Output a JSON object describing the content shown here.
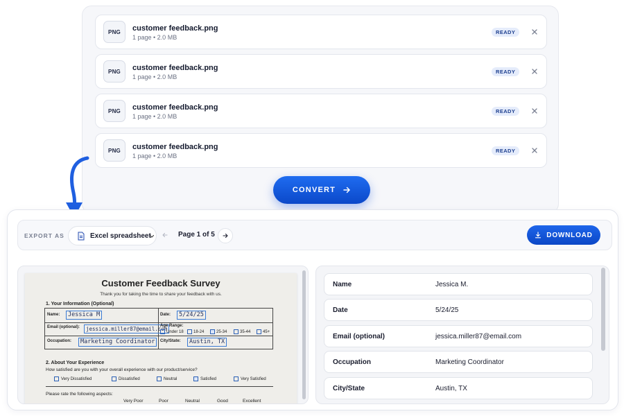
{
  "uploader": {
    "files": [
      {
        "badge": "PNG",
        "name": "customer feedback.png",
        "meta": "1 page  •  2.0 MB",
        "status": "READY"
      },
      {
        "badge": "PNG",
        "name": "customer feedback.png",
        "meta": "1 page  •  2.0 MB",
        "status": "READY"
      },
      {
        "badge": "PNG",
        "name": "customer feedback.png",
        "meta": "1 page  •  2.0 MB",
        "status": "READY"
      },
      {
        "badge": "PNG",
        "name": "customer feedback.png",
        "meta": "1 page  •  2.0 MB",
        "status": "READY"
      }
    ],
    "convert_label": "CONVERT"
  },
  "toolbar": {
    "export_label": "EXPORT AS",
    "format": "Excel spreadsheet",
    "page_label": "Page 1 of 5",
    "download_label": "DOWNLOAD"
  },
  "scan": {
    "title": "Customer Feedback Survey",
    "subtitle": "Thank you for taking the time to share your feedback with us.",
    "section1": "1.  Your Information (Optional)",
    "name_label": "Name:",
    "name_value": "Jessica M",
    "date_label": "Date:",
    "date_value": "5/24/25",
    "email_label": "Email (optional):",
    "email_value": "jessica.miller87@email.com",
    "age_label": "Age Range:",
    "age_options": [
      "Under 18",
      "18-24",
      "25-34",
      "35-44",
      "45+"
    ],
    "occupation_label": "Occupation:",
    "occupation_value": "Marketing Coordinator",
    "city_label": "City/State:",
    "city_value": "Austin, TX",
    "section2": "2.  About Your Experience",
    "question": "How satisfied are you with your overall experience with our product/service?",
    "satisfaction_options": [
      "Very Dissatisfied",
      "Dissatisfied",
      "Neutral",
      "Satisfied",
      "Very Satisfied"
    ],
    "rate_prompt": "Please rate the following aspects:",
    "rating_headers": [
      "Very Poor",
      "Poor",
      "Neutral",
      "Good",
      "Excellent"
    ]
  },
  "fields": [
    {
      "label": "Name",
      "value": "Jessica M."
    },
    {
      "label": "Date",
      "value": "5/24/25"
    },
    {
      "label": "Email (optional)",
      "value": "jessica.miller87@email.com"
    },
    {
      "label": "Occupation",
      "value": "Marketing Coordinator"
    },
    {
      "label": "City/State",
      "value": "Austin, TX"
    }
  ],
  "colors": {
    "accent": "#0b48c9",
    "ready_badge_bg": "#e5ecfb",
    "handwriting_box": "#3a7bd5"
  },
  "icons": {
    "file_badge": "png-file-icon",
    "remove": "close-icon",
    "convert": "arrow-right-icon",
    "format": "document-icon",
    "dropdown": "chevron-down-icon",
    "prev": "arrow-left-icon",
    "next": "arrow-right-icon",
    "download": "download-icon",
    "flow": "curved-arrow-down-icon"
  }
}
